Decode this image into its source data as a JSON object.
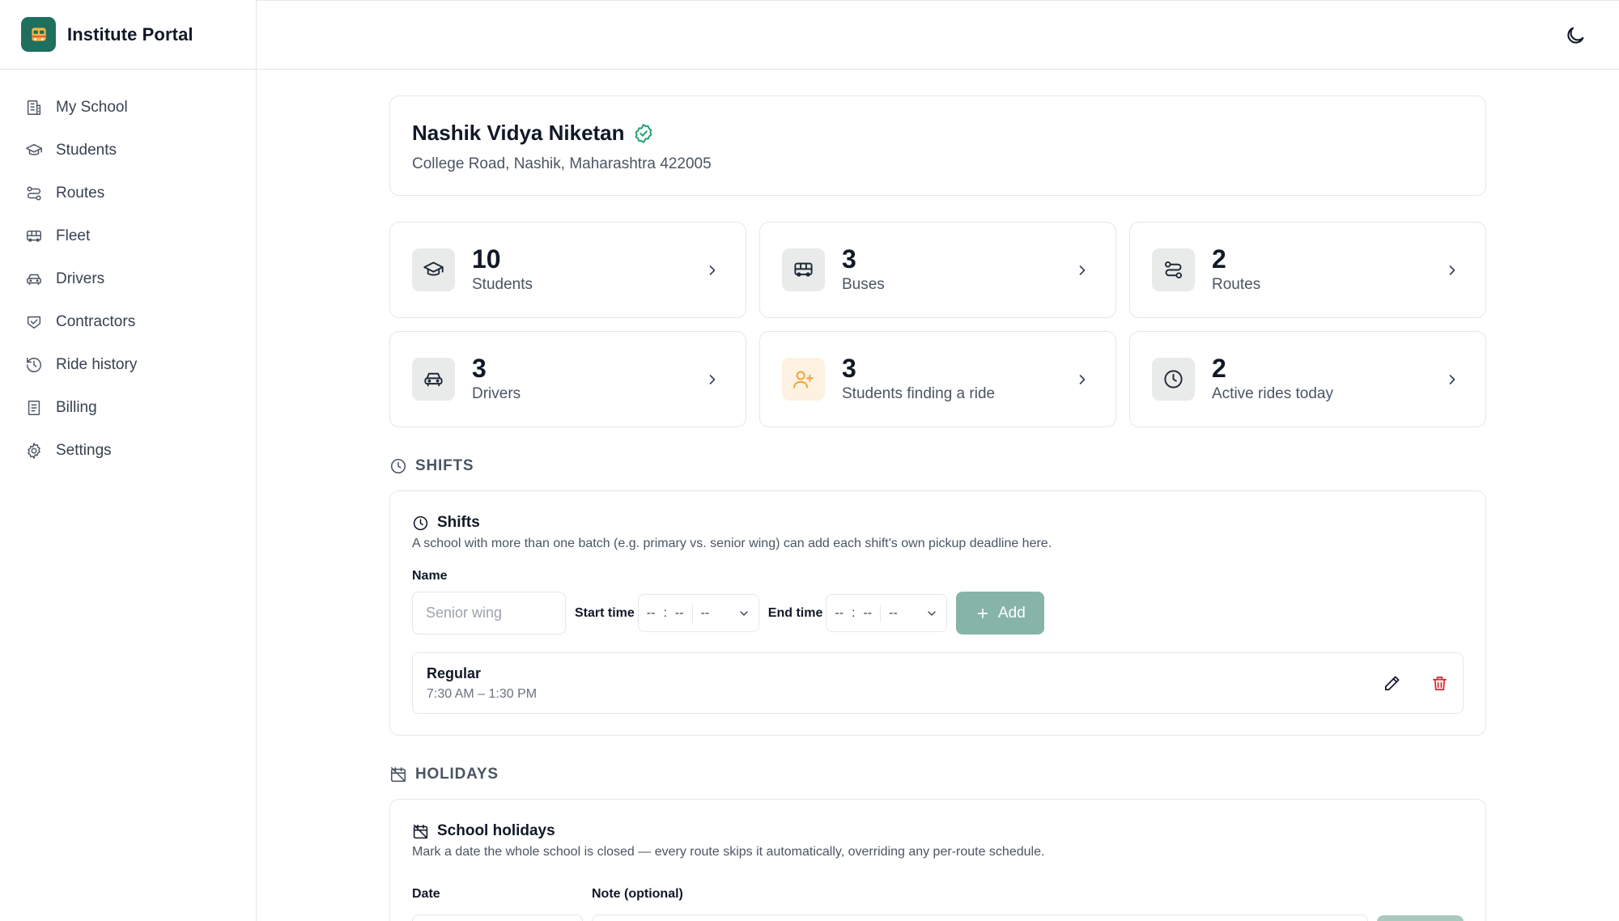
{
  "app": {
    "title": "Institute Portal"
  },
  "sidebar": {
    "items": [
      {
        "label": "My School",
        "icon": "building-icon"
      },
      {
        "label": "Students",
        "icon": "graduation-cap-icon"
      },
      {
        "label": "Routes",
        "icon": "route-icon"
      },
      {
        "label": "Fleet",
        "icon": "bus-icon"
      },
      {
        "label": "Drivers",
        "icon": "car-icon"
      },
      {
        "label": "Contractors",
        "icon": "handshake-icon"
      },
      {
        "label": "Ride history",
        "icon": "history-icon"
      },
      {
        "label": "Billing",
        "icon": "receipt-icon"
      },
      {
        "label": "Settings",
        "icon": "gear-icon"
      }
    ]
  },
  "school": {
    "name": "Nashik Vidya Niketan",
    "address": "College Road, Nashik, Maharashtra 422005",
    "verified_icon": "verified-badge-icon",
    "verified_color": "#22a06b"
  },
  "stats": [
    {
      "value": "10",
      "label": "Students",
      "icon": "graduation-cap-icon"
    },
    {
      "value": "3",
      "label": "Buses",
      "icon": "bus-icon"
    },
    {
      "value": "2",
      "label": "Routes",
      "icon": "route-icon"
    },
    {
      "value": "3",
      "label": "Drivers",
      "icon": "car-icon"
    },
    {
      "value": "3",
      "label": "Students finding a ride",
      "icon": "user-plus-icon",
      "accent": "#f5a03a"
    },
    {
      "value": "2",
      "label": "Active rides today",
      "icon": "clock-icon"
    }
  ],
  "shifts_section": {
    "heading": "SHIFTS",
    "panel_title": "Shifts",
    "description": "A school with more than one batch (e.g. primary vs. senior wing) can add each shift's own pickup deadline here.",
    "name_label": "Name",
    "name_placeholder": "Senior wing",
    "start_label": "Start time",
    "end_label": "End time",
    "time_placeholder_hour": "--",
    "time_placeholder_sep": ":",
    "time_placeholder_min": "--",
    "time_placeholder_ampm": "--",
    "add_label": "Add",
    "items": [
      {
        "name": "Regular",
        "time": "7:30 AM – 1:30 PM"
      }
    ]
  },
  "holidays_section": {
    "heading": "HOLIDAYS",
    "panel_title": "School holidays",
    "description": "Mark a date the whole school is closed — every route skips it automatically, overriding any per-route schedule.",
    "date_label": "Date",
    "note_label": "Note (optional)"
  },
  "colors": {
    "brand": "#1f6f5f",
    "primary_button": "#86b5a8",
    "delete": "#dc2626"
  }
}
